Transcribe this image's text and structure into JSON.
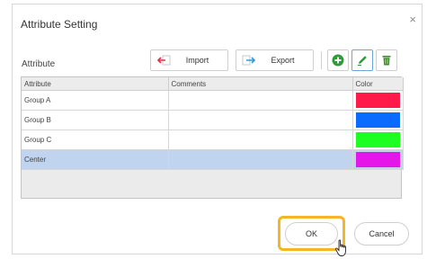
{
  "dialog": {
    "title": "Attribute Setting",
    "close_glyph": "×",
    "section_label": "Attribute"
  },
  "toolbar": {
    "import_label": "Import",
    "export_label": "Export",
    "icons": [
      "import-icon",
      "export-icon",
      "add-icon",
      "edit-icon",
      "delete-icon"
    ],
    "add_color": "#2e9a3a",
    "edit_color": "#2e9a3a",
    "delete_color": "#3f8a2c"
  },
  "table": {
    "columns": [
      "Attribute",
      "Comments",
      "Color"
    ],
    "rows": [
      {
        "attribute": "Group A",
        "comments": "",
        "color": "#ff1a4a",
        "selected": false
      },
      {
        "attribute": "Group B",
        "comments": "",
        "color": "#0a6cff",
        "selected": false
      },
      {
        "attribute": "Group C",
        "comments": "",
        "color": "#1dff21",
        "selected": false
      },
      {
        "attribute": "Center",
        "comments": "",
        "color": "#e516e8",
        "selected": true
      }
    ]
  },
  "footer": {
    "ok_label": "OK",
    "cancel_label": "Cancel",
    "highlight_color": "#f4b526"
  }
}
